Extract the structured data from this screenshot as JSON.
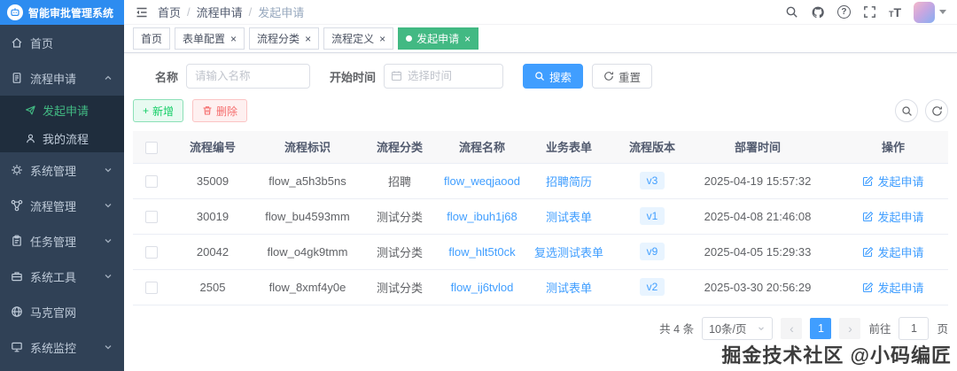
{
  "theme": {
    "primary": "#409eff",
    "success": "#42b983",
    "danger": "#f56c6c",
    "sidebar_bg": "#304156",
    "submenu_bg": "#1f2d3d",
    "logo_bg": "#2d8cf0",
    "badge_bg": "#e8f4ff"
  },
  "app": {
    "title": "智能审批管理系统",
    "logo_icon": "robot-logo-icon"
  },
  "glyphs": {
    "slash": "/",
    "close": "×",
    "plus": "+",
    "question": "?",
    "font_small": "T",
    "font_large": "T",
    "prev": "‹",
    "next": "›"
  },
  "sidebar": {
    "items": [
      {
        "label": "首页",
        "icon": "home-icon"
      },
      {
        "label": "流程申请",
        "icon": "document-icon",
        "expanded": true,
        "children": [
          {
            "label": "发起申请",
            "icon": "send-icon",
            "active": true
          },
          {
            "label": "我的流程",
            "icon": "user-icon",
            "active": false
          }
        ]
      },
      {
        "label": "系统管理",
        "icon": "gear-icon",
        "has_children": true
      },
      {
        "label": "流程管理",
        "icon": "flow-icon",
        "has_children": true
      },
      {
        "label": "任务管理",
        "icon": "clipboard-icon",
        "has_children": true
      },
      {
        "label": "系统工具",
        "icon": "toolbox-icon",
        "has_children": true
      },
      {
        "label": "马克官网",
        "icon": "globe-icon",
        "has_children": false
      },
      {
        "label": "系统监控",
        "icon": "monitor-icon",
        "has_children": true
      }
    ]
  },
  "header": {
    "breadcrumb": [
      "首页",
      "流程申请",
      "发起申请"
    ],
    "right_icons": [
      "search-icon",
      "github-icon",
      "question-icon",
      "fullscreen-icon",
      "font-size-icon",
      "avatar"
    ]
  },
  "tabs": [
    {
      "label": "首页",
      "closable": false,
      "active": false
    },
    {
      "label": "表单配置",
      "closable": true,
      "active": false
    },
    {
      "label": "流程分类",
      "closable": true,
      "active": false
    },
    {
      "label": "流程定义",
      "closable": true,
      "active": false
    },
    {
      "label": "发起申请",
      "closable": true,
      "active": true
    }
  ],
  "filters": {
    "name_label": "名称",
    "name_placeholder": "请输入名称",
    "time_label": "开始时间",
    "time_placeholder": "选择时间",
    "search_label": "搜索",
    "reset_label": "重置"
  },
  "toolbar": {
    "add_label": "新增",
    "delete_label": "删除"
  },
  "table": {
    "columns": [
      "流程编号",
      "流程标识",
      "流程分类",
      "流程名称",
      "业务表单",
      "流程版本",
      "部署时间",
      "操作"
    ],
    "action_label": "发起申请",
    "rows": [
      {
        "no": "35009",
        "key": "flow_a5h3b5ns",
        "category": "招聘",
        "name": "flow_weqjaood",
        "form": "招聘简历",
        "version": "v3",
        "time": "2025-04-19 15:57:32"
      },
      {
        "no": "30019",
        "key": "flow_bu4593mm",
        "category": "测试分类",
        "name": "flow_ibuh1j68",
        "form": "测试表单",
        "version": "v1",
        "time": "2025-04-08 21:46:08"
      },
      {
        "no": "20042",
        "key": "flow_o4gk9tmm",
        "category": "测试分类",
        "name": "flow_hlt5t0ck",
        "form": "复选测试表单",
        "version": "v9",
        "time": "2025-04-05 15:29:33"
      },
      {
        "no": "2505",
        "key": "flow_8xmf4y0e",
        "category": "测试分类",
        "name": "flow_ij6tvlod",
        "form": "测试表单",
        "version": "v2",
        "time": "2025-03-30 20:56:29"
      }
    ]
  },
  "pagination": {
    "total_text": "共 4 条",
    "page_size_text": "10条/页",
    "current_page": "1",
    "goto_label": "前往",
    "goto_value": "1",
    "unit_label": "页"
  },
  "watermark": "掘金技术社区 @小码编匠"
}
